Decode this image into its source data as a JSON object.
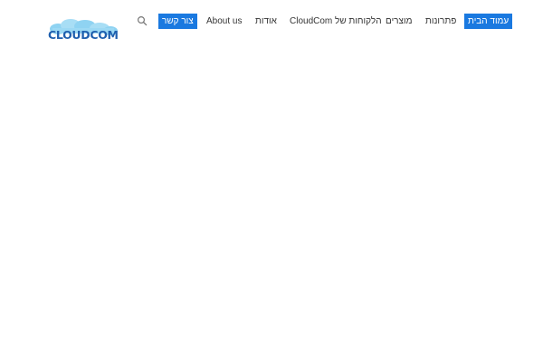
{
  "header": {
    "logo": {
      "text": "CLOUDCOM",
      "brand_color": "#1f5fae",
      "cloud_color": "#8fd3f2"
    },
    "search": {
      "icon": "search-icon",
      "icon_color": "#777777"
    },
    "nav": {
      "contact": "צור קשר",
      "about_en": "About us",
      "about_he": "אודות",
      "customers": "הלקוחות של CloudCom",
      "products": "מוצרים",
      "solutions": "פתרונות",
      "home": "עמוד הבית"
    },
    "accent_color": "#1a79e0"
  }
}
